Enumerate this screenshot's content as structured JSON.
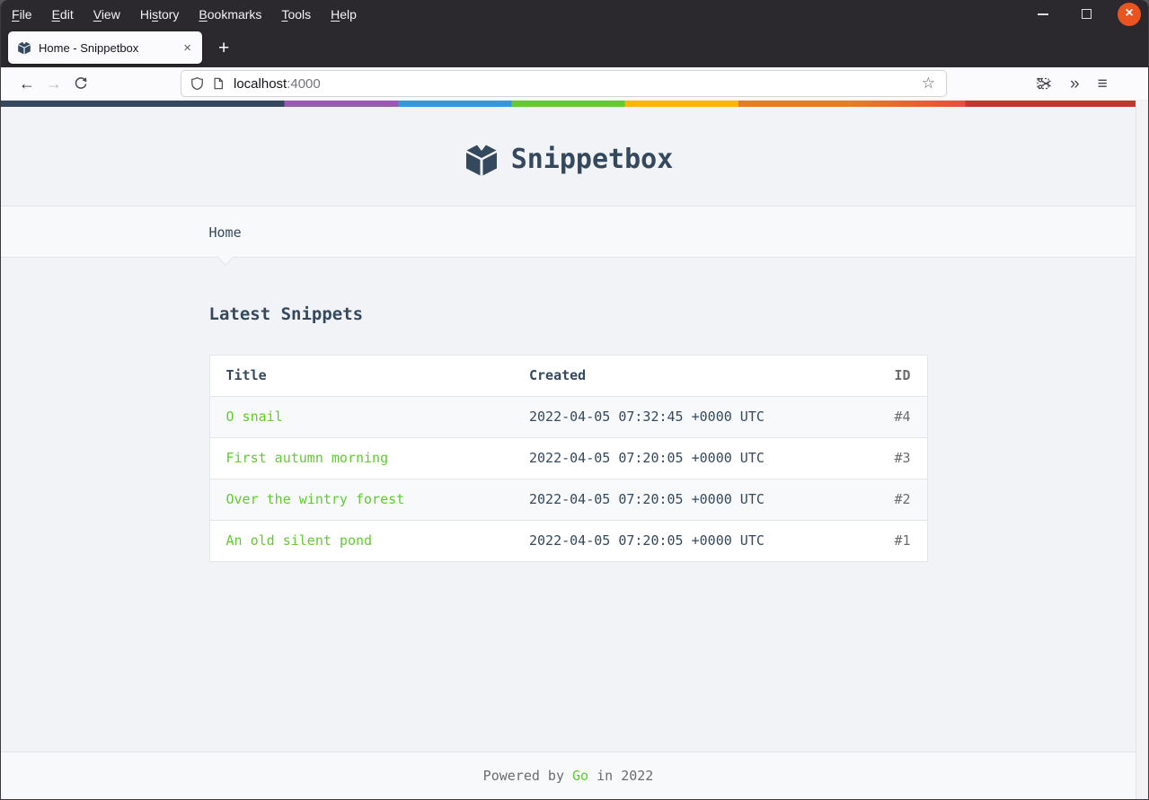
{
  "browser": {
    "menubar": {
      "items": [
        {
          "pre": "",
          "key": "F",
          "post": "ile"
        },
        {
          "pre": "",
          "key": "E",
          "post": "dit"
        },
        {
          "pre": "",
          "key": "V",
          "post": "iew"
        },
        {
          "pre": "Hi",
          "key": "s",
          "post": "tory"
        },
        {
          "pre": "",
          "key": "B",
          "post": "ookmarks"
        },
        {
          "pre": "",
          "key": "T",
          "post": "ools"
        },
        {
          "pre": "",
          "key": "H",
          "post": "elp"
        }
      ],
      "window_controls": {
        "minimize": "minimize-icon",
        "maximize": "maximize-icon",
        "close_glyph": "×"
      }
    },
    "tabbar": {
      "tab_title": "Home - Snippetbox",
      "tab_close_glyph": "×",
      "new_tab_glyph": "+"
    },
    "toolbar": {
      "back_glyph": "←",
      "forward_glyph": "→",
      "url_host": "localhost",
      "url_port": ":4000",
      "star_glyph": "☆",
      "overflow_glyph": "»",
      "menu_glyph": "≡"
    }
  },
  "page": {
    "header": {
      "site_title": "Snippetbox"
    },
    "nav": {
      "home_label": "Home"
    },
    "main": {
      "heading": "Latest Snippets",
      "table": {
        "col_title": "Title",
        "col_created": "Created",
        "col_id": "ID",
        "rows": [
          {
            "title": "O snail",
            "created": "2022-04-05 07:32:45 +0000 UTC",
            "id": "#4"
          },
          {
            "title": "First autumn morning",
            "created": "2022-04-05 07:20:05 +0000 UTC",
            "id": "#3"
          },
          {
            "title": "Over the wintry forest",
            "created": "2022-04-05 07:20:05 +0000 UTC",
            "id": "#2"
          },
          {
            "title": "An old silent pond",
            "created": "2022-04-05 07:20:05 +0000 UTC",
            "id": "#1"
          }
        ]
      }
    },
    "footer": {
      "prefix": "Powered by ",
      "link": "Go",
      "suffix": " in 2022"
    }
  },
  "colors": {
    "text": "#34495E",
    "muted": "#6A6C6F",
    "accent_green": "#62CB31",
    "border": "#E4E5E7",
    "body_bg": "#F1F3F6",
    "panel_bg": "#F7F9FA",
    "close_button": "#E95420",
    "gradient": [
      "#34495E",
      "#9B59B6",
      "#3498DB",
      "#62CB31",
      "#FFB606",
      "#E67E22",
      "#E74C3C",
      "#C0392B"
    ]
  }
}
